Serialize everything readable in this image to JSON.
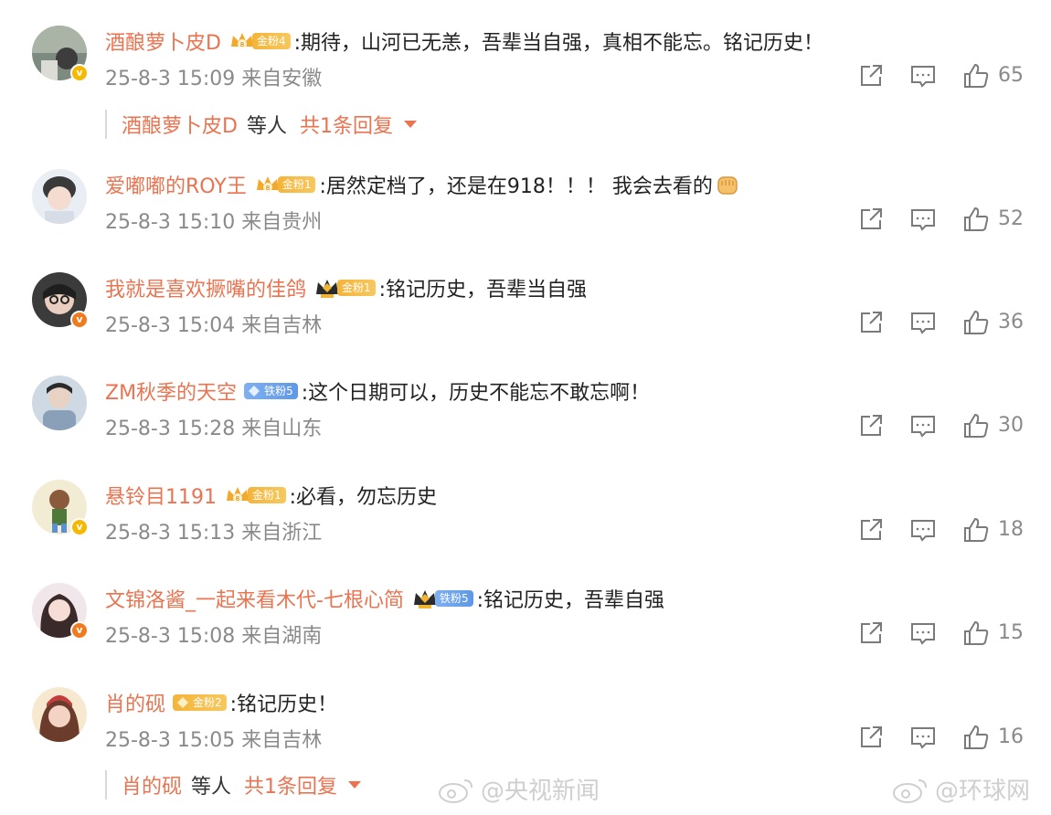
{
  "comments": [
    {
      "username": "酒酿萝卜皮D",
      "fan_badge": "金粉4",
      "fan_type": "gold",
      "text": ":期待，山河已无恙，吾辈当自强，真相不能忘。铭记历史！",
      "time": "25-8-3 15:09 来自安徽",
      "likes": "65",
      "verified": "gold",
      "reply": {
        "name": "酒酿萝卜皮D",
        "etc": "等人",
        "count": "共1条回复"
      }
    },
    {
      "username": "爱嘟嘟的ROY王",
      "fan_badge": "金粉1",
      "fan_type": "gold",
      "text": ":居然定档了，还是在918！！！ 我会去看的",
      "time": "25-8-3 15:10 来自贵州",
      "likes": "52",
      "verified": "none",
      "emoji": "fist"
    },
    {
      "username": "我就是喜欢撅嘴的佳鸽",
      "fan_badge": "金粉1",
      "fan_type": "gold-crown-dark",
      "text": ":铭记历史，吾辈当自强",
      "time": "25-8-3 15:04 来自吉林",
      "likes": "36",
      "verified": "orange"
    },
    {
      "username": "ZM秋季的天空",
      "fan_badge": "铁粉5",
      "fan_type": "iron",
      "text": ":这个日期可以，历史不能忘不敢忘啊！",
      "time": "25-8-3 15:28 来自山东",
      "likes": "30",
      "verified": "none"
    },
    {
      "username": "悬铃目1191",
      "fan_badge": "金粉1",
      "fan_type": "gold",
      "text": ":必看，勿忘历史",
      "time": "25-8-3 15:13 来自浙江",
      "likes": "18",
      "verified": "gold"
    },
    {
      "username": "文锦洛酱_一起来看木代-七根心简",
      "fan_badge": "铁粉5",
      "fan_type": "iron-crown-dark",
      "text": ":铭记历史，吾辈自强",
      "time": "25-8-3 15:08 来自湖南",
      "likes": "15",
      "verified": "orange"
    },
    {
      "username": "肖的砚",
      "fan_badge": "金粉2",
      "fan_type": "gold-small",
      "text": ":铭记历史！",
      "time": "25-8-3 15:05 来自吉林",
      "likes": "16",
      "verified": "none",
      "reply": {
        "name": "肖的砚",
        "etc": "等人",
        "count": "共1条回复"
      }
    }
  ],
  "watermarks": [
    "@央视新闻",
    "@环球网"
  ],
  "icons": {
    "share": "share-icon",
    "comment": "comment-icon",
    "like": "like-icon"
  },
  "colors": {
    "username": "#eb7350",
    "meta": "#8a8a8a",
    "gold_badge": "#f4b43a",
    "iron_badge": "#6aa3ec"
  }
}
